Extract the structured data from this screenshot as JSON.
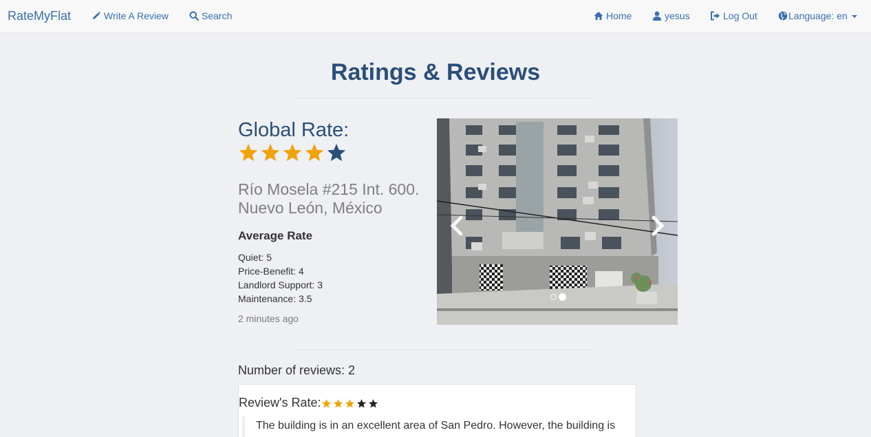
{
  "navbar": {
    "brand": "RateMyFlat",
    "write_review": "Write A Review",
    "search": "Search",
    "home": "Home",
    "user": "yesus",
    "logout": "Log Out",
    "language": "Language: en"
  },
  "page": {
    "title": "Ratings & Reviews"
  },
  "flat": {
    "global_rate_label": "Global Rate:",
    "global_rate": 4,
    "address_line1": "Río Mosela #215 Int. 600.",
    "address_line2": "Nuevo León, México",
    "average_title": "Average Rate",
    "metrics": [
      "Quiet: 5",
      "Price-Benefit: 4",
      "Landlord Support: 3",
      "Maintenance: 3.5"
    ],
    "time_ago": "2 minutes ago"
  },
  "carousel": {
    "slide_count": 2,
    "active_slide": 2
  },
  "reviews": {
    "count_label": "Number of reviews: 2",
    "items": [
      {
        "rate_label": "Review's Rate:",
        "rate": 3,
        "text": "The building is in an excellent area of San Pedro. However, the building is"
      }
    ]
  },
  "colors": {
    "brand_link": "#3a6fb0",
    "heading": "#2b4e7a",
    "star_filled": "#f0a30a",
    "star_empty_global": "#2b4e7a",
    "star_empty_review": "#222222"
  }
}
